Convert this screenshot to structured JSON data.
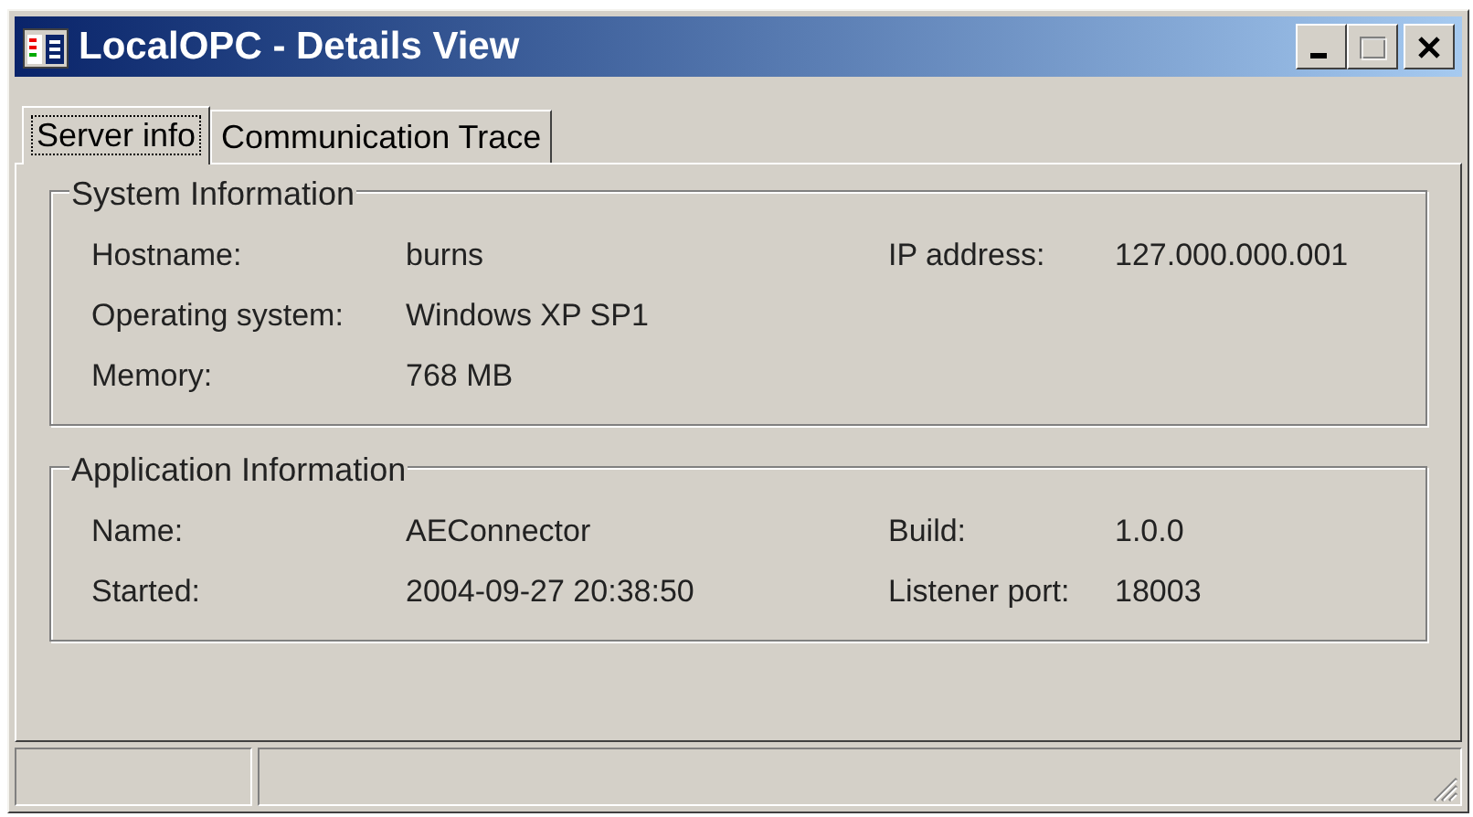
{
  "window": {
    "title": "LocalOPC - Details View",
    "buttons": [
      {
        "kind": "minimize",
        "disabled": false
      },
      {
        "kind": "maximize",
        "disabled": true
      },
      {
        "kind": "close",
        "disabled": false
      }
    ]
  },
  "tabs": [
    {
      "label": "Server info",
      "selected": true
    },
    {
      "label": "Communication Trace",
      "selected": false
    }
  ],
  "groups": [
    {
      "title": "System Information",
      "rows": [
        [
          {
            "label": "Hostname:",
            "value": "burns"
          },
          {
            "label": "IP address:",
            "value": "127.000.000.001"
          }
        ],
        [
          {
            "label": "Operating system:",
            "value": "Windows XP SP1"
          }
        ],
        [
          {
            "label": "Memory:",
            "value": "768 MB"
          }
        ]
      ]
    },
    {
      "title": "Application Information",
      "rows": [
        [
          {
            "label": "Name:",
            "value": "AEConnector"
          },
          {
            "label": "Build:",
            "value": "1.0.0"
          }
        ],
        [
          {
            "label": "Started:",
            "value": "2004-09-27 20:38:50"
          },
          {
            "label": "Listener port:",
            "value": "18003"
          }
        ]
      ]
    }
  ]
}
